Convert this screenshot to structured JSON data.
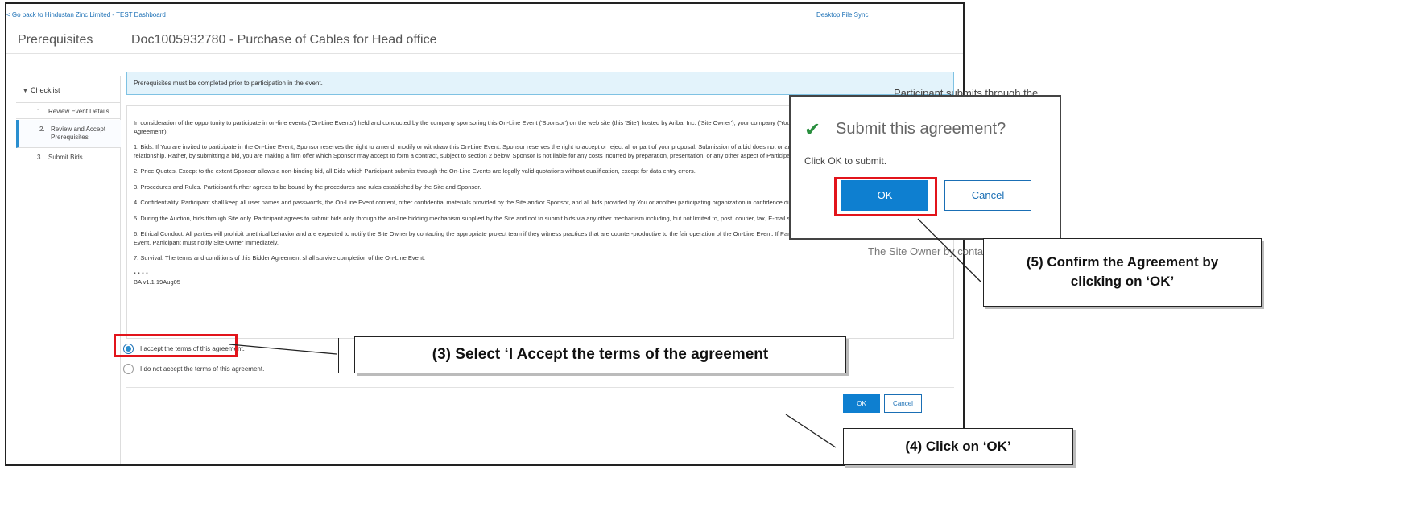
{
  "header": {
    "back_link": "< Go back to Hindustan Zinc Limited",
    "dashboard_link": " - TEST Dashboard",
    "sync_link": "Desktop File Sync",
    "prereq_title": "Prerequisites",
    "doc_title": "Doc1005932780 - Purchase of Cables for Head office"
  },
  "sidebar": {
    "checklist_label": "Checklist",
    "steps": [
      {
        "num": "1.",
        "label": "Review Event Details"
      },
      {
        "num": "2.",
        "label": "Review and Accept Prerequisites"
      },
      {
        "num": "3.",
        "label": "Submit Bids"
      }
    ]
  },
  "notice": "Prerequisites must be completed prior to participation in the event.",
  "terms": {
    "intro": "In consideration of the opportunity to participate in on-line events ('On-Line Events') held and conducted by the company sponsoring this On-Line Event ('Sponsor') on the web site (this 'Site') hosted by Ariba, Inc. ('Site Owner'), your company ('You') agrees to the following terms and conditions ('Bidder Agreement'):",
    "p1": "1. Bids. If You are invited to participate in the On-Line Event, Sponsor reserves the right to amend, modify or withdraw this On-Line Event. Sponsor reserves the right to accept or reject all or part of your proposal. Submission of a bid does not or any expectation by Participant of a future business relationship. Rather, by submitting a bid, you are making a firm offer which Sponsor may accept to form a contract, subject to section 2 below. Sponsor is not liable for any costs incurred by preparation, presentation, or any other aspect of Participant's bid.",
    "p2": "2. Price Quotes. Except to the extent Sponsor allows a non-binding bid, all Bids which Participant submits through the On-Line Events are legally valid quotations without qualification, except for data entry errors.",
    "p3": "3. Procedures and Rules. Participant further agrees to be bound by the procedures and rules established by the Site and Sponsor.",
    "p4": "4. Confidentiality. Participant shall keep all user names and passwords, the On-Line Event content, other confidential materials provided by the Site and/or Sponsor, and all bids provided by You or another participating organization in confidence disclose the foregoing to any third party.",
    "p5": "5. During the Auction, bids through Site only. Participant agrees to submit bids only through the on-line bidding mechanism supplied by the Site and not to submit bids via any other mechanism including, but not limited to, post, courier, fax, E-mail specifically requested by Sponsor.",
    "p6": "6. Ethical Conduct. All parties will prohibit unethical behavior and are expected to notify the Site Owner by contacting the appropriate project team if they witness practices that are counter-productive to the fair operation of the On-Line Event. If Participant experiences any difficulties during a live On-Line Event, Participant must notify Site Owner immediately.",
    "p7": "7. Survival. The terms and conditions of this Bidder Agreement shall survive completion of the On-Line Event.",
    "stars": "* * * *",
    "version": "BA v1.1 19Aug05"
  },
  "radios": {
    "accept_label": "I accept the terms of this agreement.",
    "decline_label": "I do not accept the terms of this agreement.",
    "selected": "accept"
  },
  "footer": {
    "ok_label": "OK",
    "cancel_label": "Cancel"
  },
  "background_text": {
    "line1": "Participant submits through the On-Line Events are lega",
    "line2": "e",
    "line3": "The Site Owner by contacting the approp"
  },
  "dialog": {
    "icon": "check-icon",
    "title": "Submit this agreement?",
    "message": "Click OK to submit.",
    "ok_label": "OK",
    "cancel_label": "Cancel"
  },
  "callouts": {
    "step3": "(3) Select ‘I Accept the terms of the agreement",
    "step4": "(4) Click on ‘OK’",
    "step5_line1": "(5) Confirm the Agreement by",
    "step5_line2": "clicking on ‘OK’"
  },
  "colors": {
    "highlight_red": "#e2141b",
    "primary_blue": "#0e7fd0",
    "notice_bg": "#e3f3fb",
    "check_green": "#2a8f3f"
  }
}
